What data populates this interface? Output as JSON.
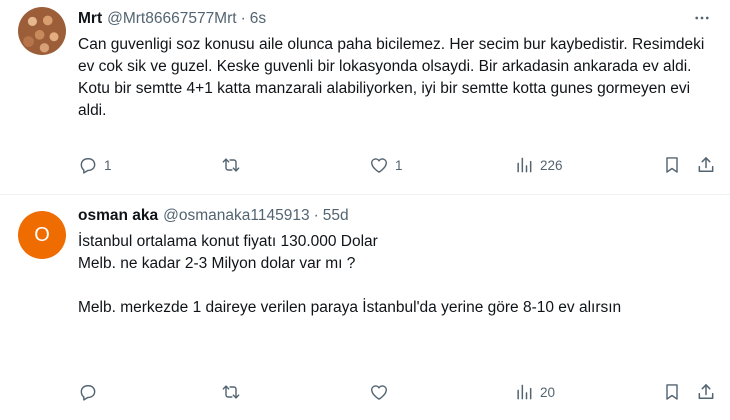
{
  "tweets": [
    {
      "name": "Mrt",
      "handle": "@Mrt86667577Mrt",
      "separator": "·",
      "time": "6s",
      "text": "Can guvenligi soz konusu aile olunca paha bicilemez. Her secim bur kaybedistir. Resimdeki ev cok sik ve guzel. Keske guvenli bir lokasyonda olsaydi. Bir arkadasin ankarada ev aldi. Kotu bir semtte 4+1 katta manzarali alabiliyorken, iyi bir semtte kotta gunes gormeyen evi aldi.",
      "replies": "1",
      "retweets": "",
      "likes": "1",
      "views": "226"
    },
    {
      "name": "osman aka",
      "handle": "@osmanaka1145913",
      "separator": "·",
      "time": "55d",
      "avatar_letter": "O",
      "avatar_color": "#ef6c00",
      "text_lines": [
        "İstanbul ortalama konut fiyatı 130.000 Dolar",
        "Melb. ne kadar 2-3 Milyon dolar var mı ?",
        " ",
        "Melb. merkezde 1 daireye verilen paraya İstanbul'da yerine göre 8-10 ev alırsın"
      ],
      "replies": "",
      "retweets": "",
      "likes": "",
      "views": "20"
    }
  ],
  "icons": [
    "more-icon",
    "reply-icon",
    "retweet-icon",
    "like-icon",
    "views-icon",
    "bookmark-icon",
    "share-icon"
  ],
  "colors": {
    "text": "#0f1419",
    "secondary": "#536471",
    "divider": "#eff3f4"
  }
}
